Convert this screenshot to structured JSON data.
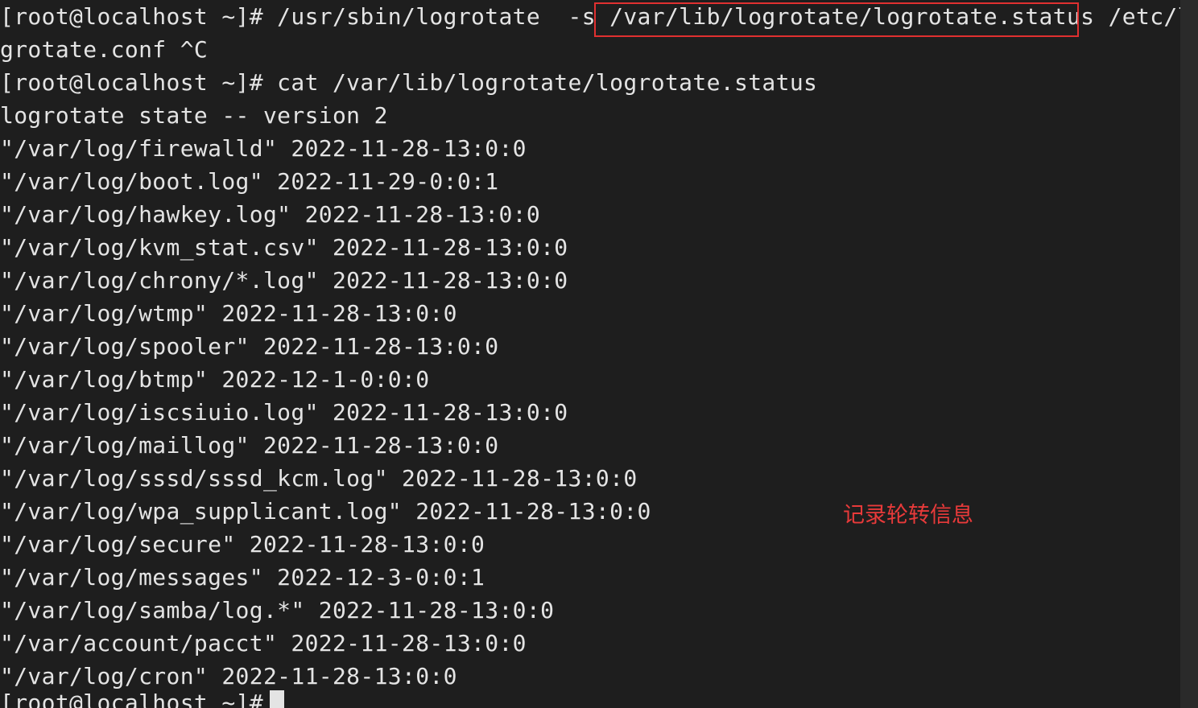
{
  "terminal": {
    "lines": [
      "[root@localhost ~]# /usr/sbin/logrotate  -s /var/lib/logrotate/logrotate.status /etc/lo",
      "grotate.conf ^C",
      "[root@localhost ~]# cat /var/lib/logrotate/logrotate.status",
      "logrotate state -- version 2",
      "\"/var/log/firewalld\" 2022-11-28-13:0:0",
      "\"/var/log/boot.log\" 2022-11-29-0:0:1",
      "\"/var/log/hawkey.log\" 2022-11-28-13:0:0",
      "\"/var/log/kvm_stat.csv\" 2022-11-28-13:0:0",
      "\"/var/log/chrony/*.log\" 2022-11-28-13:0:0",
      "\"/var/log/wtmp\" 2022-11-28-13:0:0",
      "\"/var/log/spooler\" 2022-11-28-13:0:0",
      "\"/var/log/btmp\" 2022-12-1-0:0:0",
      "\"/var/log/iscsiuio.log\" 2022-11-28-13:0:0",
      "\"/var/log/maillog\" 2022-11-28-13:0:0",
      "\"/var/log/sssd/sssd_kcm.log\" 2022-11-28-13:0:0",
      "\"/var/log/wpa_supplicant.log\" 2022-11-28-13:0:0",
      "\"/var/log/secure\" 2022-11-28-13:0:0",
      "\"/var/log/messages\" 2022-12-3-0:0:1",
      "\"/var/log/samba/log.*\" 2022-11-28-13:0:0",
      "\"/var/account/pacct\" 2022-11-28-13:0:0",
      "\"/var/log/cron\" 2022-11-28-13:0:0",
      "[root@localhost ~]# "
    ],
    "prompt": "[root@localhost ~]#"
  },
  "annotation": {
    "text": "记录轮转信息",
    "color": "#e83a3a"
  },
  "colors": {
    "background": "#1e1e1e",
    "foreground": "#e4e4e4",
    "highlight_box": "#e03030"
  }
}
